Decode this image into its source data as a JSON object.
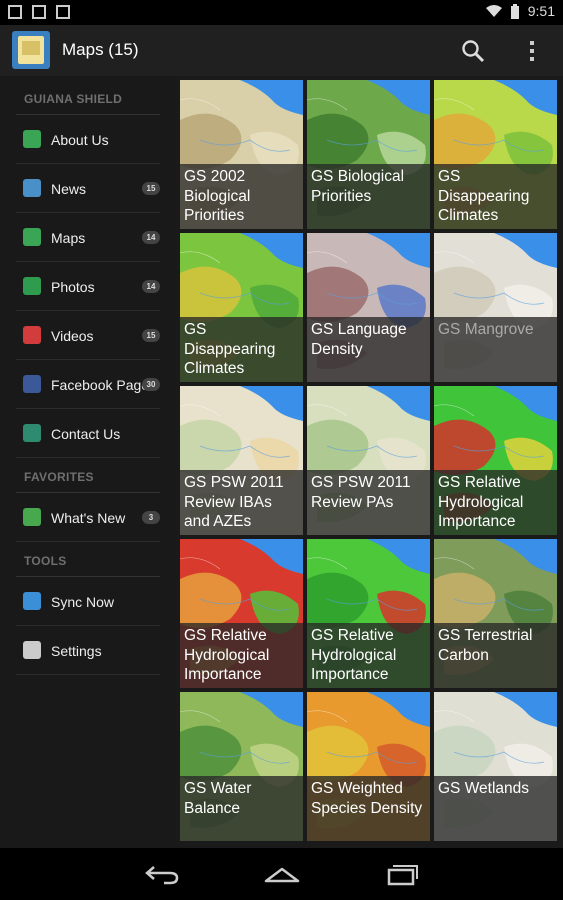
{
  "status": {
    "time": "9:51"
  },
  "app": {
    "title": "Maps (15)"
  },
  "drawer": {
    "sections": [
      {
        "heading": "GUIANA SHIELD",
        "items": [
          {
            "label": "About Us",
            "badge": "",
            "icon": "info-icon",
            "color": "#3aa655"
          },
          {
            "label": "News",
            "badge": "15",
            "icon": "news-icon",
            "color": "#4a90c8"
          },
          {
            "label": "Maps",
            "badge": "14",
            "icon": "maps-icon",
            "color": "#3aa655"
          },
          {
            "label": "Photos",
            "badge": "14",
            "icon": "photos-icon",
            "color": "#2e9b4f"
          },
          {
            "label": "Videos",
            "badge": "15",
            "icon": "videos-icon",
            "color": "#d23c3c"
          },
          {
            "label": "Facebook Page",
            "badge": "30",
            "icon": "facebook-icon",
            "color": "#3b5998"
          },
          {
            "label": "Contact Us",
            "badge": "",
            "icon": "contact-icon",
            "color": "#2e8b6f"
          }
        ]
      },
      {
        "heading": "FAVORITES",
        "items": [
          {
            "label": "What's New",
            "badge": "3",
            "icon": "whats-new-icon",
            "color": "#47a84e"
          }
        ]
      },
      {
        "heading": "TOOLS",
        "items": [
          {
            "label": "Sync Now",
            "badge": "",
            "icon": "sync-icon",
            "color": "#3b8fd6"
          },
          {
            "label": "Settings",
            "badge": "",
            "icon": "settings-icon",
            "color": "#cccccc"
          }
        ]
      }
    ]
  },
  "maps": [
    {
      "label": "GS 2002 Biological Priorities",
      "palette": [
        "#d9cfa8",
        "#b9a778",
        "#e8dfc0"
      ],
      "dim": false
    },
    {
      "label": "GS Biological Priorities",
      "palette": [
        "#6da84b",
        "#3f7d2e",
        "#b7d79a"
      ],
      "dim": false
    },
    {
      "label": "GS Disappearing Climates",
      "palette": [
        "#b9d94a",
        "#e0a93a",
        "#7bbf3a"
      ],
      "dim": false
    },
    {
      "label": "GS Disappearing Climates",
      "palette": [
        "#7cc63f",
        "#d8c23c",
        "#4fa83a"
      ],
      "dim": false
    },
    {
      "label": "GS Language Density",
      "palette": [
        "#c9b8b8",
        "#9b6b6b",
        "#5b79c6"
      ],
      "dim": false
    },
    {
      "label": "GS Mangrove",
      "palette": [
        "#e2dfd6",
        "#cfcab9",
        "#f2f0ea"
      ],
      "dim": true
    },
    {
      "label": "GS PSW 2011 Review IBAs and AZEs",
      "palette": [
        "#e8e2cc",
        "#c4d3a4",
        "#ebd7a6"
      ],
      "dim": false
    },
    {
      "label": "GS PSW 2011 Review PAs",
      "palette": [
        "#d7dfbf",
        "#a8c68a",
        "#e9e4cf"
      ],
      "dim": false
    },
    {
      "label": "GS Relative Hydrological Importance",
      "palette": [
        "#3fc43a",
        "#d4322c",
        "#e0d43c"
      ],
      "dim": false
    },
    {
      "label": "GS Relative Hydrological Importance",
      "palette": [
        "#d83a2e",
        "#e8a03c",
        "#54c23a"
      ],
      "dim": false
    },
    {
      "label": "GS Relative Hydrological Importance",
      "palette": [
        "#4cc83a",
        "#2e9f2e",
        "#d8352c"
      ],
      "dim": false
    },
    {
      "label": "GS Terrestrial Carbon",
      "palette": [
        "#7f9c5a",
        "#c9b06a",
        "#4d7f3c"
      ],
      "dim": false
    },
    {
      "label": "GS Water Balance",
      "palette": [
        "#8fb85a",
        "#4f8f3c",
        "#c2d488"
      ],
      "dim": false
    },
    {
      "label": "GS Weighted Species Density",
      "palette": [
        "#e89a2e",
        "#e2c33a",
        "#d25a2a"
      ],
      "dim": false
    },
    {
      "label": "GS Wetlands",
      "palette": [
        "#e0dfd4",
        "#c8d6c0",
        "#f0eee6"
      ],
      "dim": false
    }
  ],
  "theme": {
    "ocean": "#3a8fe8",
    "actionbar": "#202020",
    "drawer": "#191919"
  }
}
